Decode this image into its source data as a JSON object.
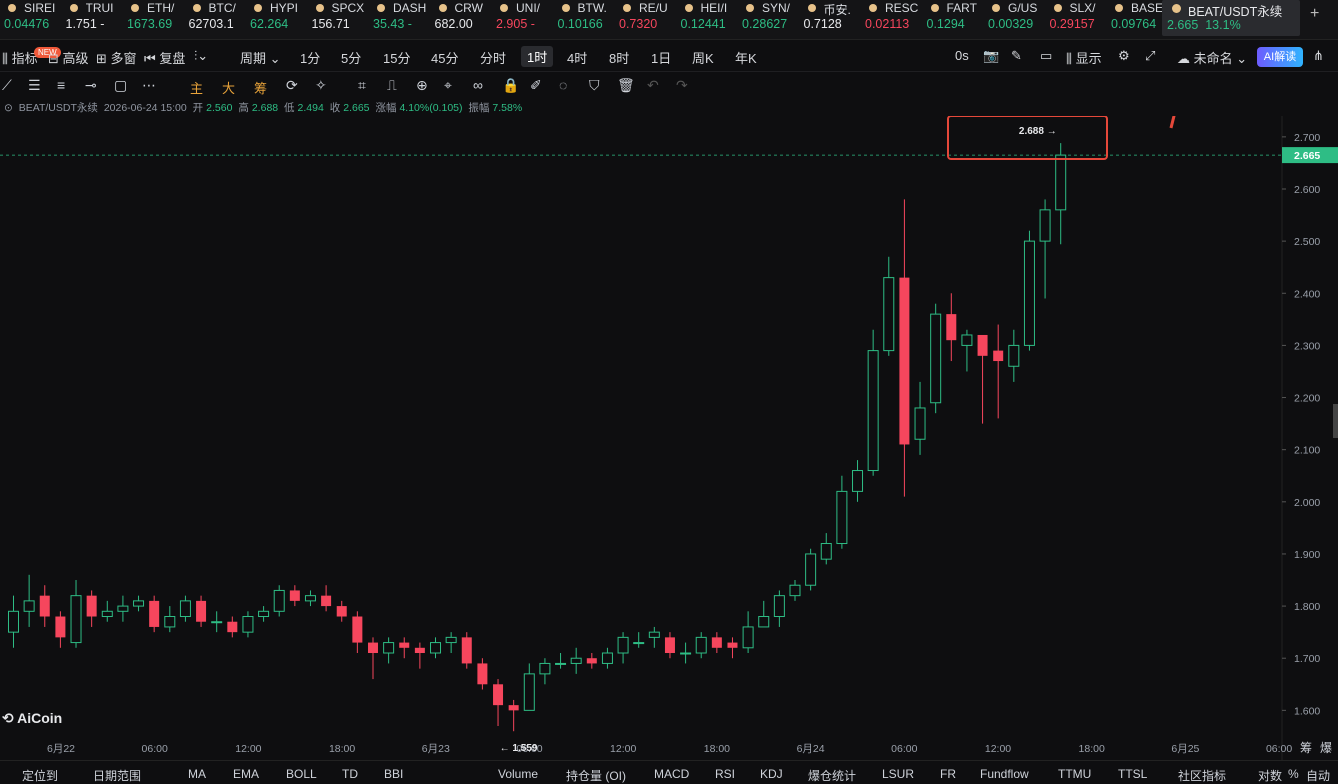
{
  "ticker": [
    {
      "name": "SIREI",
      "price": "0.04476",
      "dir": "up"
    },
    {
      "name": "TRUI",
      "price": "1.751 -",
      "dir": "wh"
    },
    {
      "name": "ETH/",
      "price": "1673.69",
      "dir": "up"
    },
    {
      "name": "BTC/",
      "price": "62703.1",
      "dir": "wh"
    },
    {
      "name": "HYPI",
      "price": "62.264",
      "dir": "up"
    },
    {
      "name": "SPCX",
      "price": "156.71",
      "dir": "wh"
    },
    {
      "name": "DASH",
      "price": "35.43 -",
      "dir": "up"
    },
    {
      "name": "CRW",
      "price": "682.00",
      "dir": "wh"
    },
    {
      "name": "UNI/",
      "price": "2.905 -",
      "dir": "dn"
    },
    {
      "name": "BTW.",
      "price": "0.10166",
      "dir": "up"
    },
    {
      "name": "RE/U",
      "price": "0.7320",
      "dir": "dn"
    },
    {
      "name": "HEI/I",
      "price": "0.12441",
      "dir": "up"
    },
    {
      "name": "SYN/",
      "price": "0.28627",
      "dir": "up"
    },
    {
      "name": "币安.",
      "price": "0.7128",
      "dir": "wh"
    },
    {
      "name": "RESC",
      "price": "0.02113",
      "dir": "dn"
    },
    {
      "name": "FART",
      "price": "0.1294",
      "dir": "up"
    },
    {
      "name": "G/US",
      "price": "0.00329",
      "dir": "up"
    },
    {
      "name": "SLX/",
      "price": "0.29157",
      "dir": "dn"
    },
    {
      "name": "BASE",
      "price": "0.09764",
      "dir": "up"
    }
  ],
  "active_ticker": {
    "name": "BEAT/USDT永续",
    "price": "2.665",
    "change": "13.1%"
  },
  "toolbar": {
    "indicators": "指标",
    "new_badge": "NEW",
    "advanced": "高级",
    "multi": "多窗",
    "replay": "复盘",
    "period": "周期",
    "periods": [
      "1分",
      "5分",
      "15分",
      "45分",
      "分时",
      "1时",
      "4时",
      "8时",
      "1日",
      "周K",
      "年K"
    ],
    "selected_period": "1时",
    "timer": "0s",
    "display": "显示",
    "layout_name": "未命名",
    "ai": "AI解读"
  },
  "drawbar": {
    "main": "主",
    "big": "大",
    "chip": "筹"
  },
  "info": {
    "symbol": "BEAT/USDT永续",
    "time": "2026-06-24 15:00",
    "open_label": "开",
    "open": "2.560",
    "high_label": "高",
    "high": "2.688",
    "low_label": "低",
    "low": "2.494",
    "close_label": "收",
    "close": "2.665",
    "chg_label": "涨幅",
    "chg": "4.10%(0.105)",
    "amp_label": "振幅",
    "amp": "7.58%"
  },
  "logo": "AiCoin",
  "bottom": {
    "items": [
      "定位到",
      "日期范围",
      "MA",
      "EMA",
      "BOLL",
      "TD",
      "BBI",
      "Volume",
      "持仓量 (OI)",
      "MACD",
      "RSI",
      "KDJ",
      "爆仓统计",
      "LSUR",
      "FR",
      "Fundflow",
      "TTMU",
      "TTSL",
      "社区指标",
      "对数",
      "%",
      "自动"
    ]
  },
  "colors": {
    "up": "#2ebd85",
    "down": "#f6465d",
    "accent_box": "#e5483a"
  },
  "chart_data": {
    "type": "candlestick",
    "symbol": "BEAT/USDT永续",
    "interval": "1h",
    "y_ticks": [
      1.6,
      1.7,
      1.8,
      1.9,
      2.0,
      2.1,
      2.2,
      2.3,
      2.4,
      2.5,
      2.6,
      2.7
    ],
    "ylim": [
      1.57,
      2.74
    ],
    "x_ticks": [
      "6月22",
      "06:00",
      "12:00",
      "18:00",
      "6月23",
      "06:00",
      "12:00",
      "18:00",
      "6月24",
      "06:00",
      "12:00",
      "18:00",
      "6月25",
      "06:00"
    ],
    "last_price": "2.665",
    "high_label": "2.688",
    "low_label": "1.559",
    "candles": [
      [
        1.75,
        1.79,
        1.82,
        1.72
      ],
      [
        1.79,
        1.81,
        1.86,
        1.76
      ],
      [
        1.82,
        1.78,
        1.84,
        1.76
      ],
      [
        1.78,
        1.74,
        1.79,
        1.72
      ],
      [
        1.73,
        1.82,
        1.85,
        1.72
      ],
      [
        1.82,
        1.78,
        1.83,
        1.76
      ],
      [
        1.78,
        1.79,
        1.81,
        1.77
      ],
      [
        1.79,
        1.8,
        1.82,
        1.77
      ],
      [
        1.8,
        1.81,
        1.82,
        1.79
      ],
      [
        1.81,
        1.76,
        1.82,
        1.75
      ],
      [
        1.76,
        1.78,
        1.8,
        1.75
      ],
      [
        1.78,
        1.81,
        1.82,
        1.77
      ],
      [
        1.81,
        1.77,
        1.82,
        1.76
      ],
      [
        1.77,
        1.77,
        1.79,
        1.75
      ],
      [
        1.77,
        1.75,
        1.78,
        1.74
      ],
      [
        1.75,
        1.78,
        1.79,
        1.74
      ],
      [
        1.78,
        1.79,
        1.8,
        1.77
      ],
      [
        1.79,
        1.83,
        1.84,
        1.78
      ],
      [
        1.83,
        1.81,
        1.84,
        1.8
      ],
      [
        1.81,
        1.82,
        1.83,
        1.8
      ],
      [
        1.82,
        1.8,
        1.84,
        1.79
      ],
      [
        1.8,
        1.78,
        1.81,
        1.77
      ],
      [
        1.78,
        1.73,
        1.79,
        1.71
      ],
      [
        1.73,
        1.71,
        1.74,
        1.66
      ],
      [
        1.71,
        1.73,
        1.74,
        1.69
      ],
      [
        1.73,
        1.72,
        1.74,
        1.7
      ],
      [
        1.72,
        1.71,
        1.73,
        1.68
      ],
      [
        1.71,
        1.73,
        1.74,
        1.7
      ],
      [
        1.73,
        1.74,
        1.75,
        1.71
      ],
      [
        1.74,
        1.69,
        1.75,
        1.68
      ],
      [
        1.69,
        1.65,
        1.7,
        1.64
      ],
      [
        1.65,
        1.61,
        1.66,
        1.57
      ],
      [
        1.61,
        1.6,
        1.62,
        1.56
      ],
      [
        1.6,
        1.67,
        1.69,
        1.6
      ],
      [
        1.67,
        1.69,
        1.7,
        1.65
      ],
      [
        1.69,
        1.69,
        1.71,
        1.68
      ],
      [
        1.69,
        1.7,
        1.72,
        1.67
      ],
      [
        1.7,
        1.69,
        1.71,
        1.68
      ],
      [
        1.69,
        1.71,
        1.72,
        1.68
      ],
      [
        1.71,
        1.74,
        1.75,
        1.69
      ],
      [
        1.73,
        1.73,
        1.75,
        1.72
      ],
      [
        1.74,
        1.75,
        1.76,
        1.72
      ],
      [
        1.74,
        1.71,
        1.75,
        1.7
      ],
      [
        1.71,
        1.71,
        1.73,
        1.69
      ],
      [
        1.71,
        1.74,
        1.75,
        1.7
      ],
      [
        1.74,
        1.72,
        1.75,
        1.71
      ],
      [
        1.73,
        1.72,
        1.74,
        1.7
      ],
      [
        1.72,
        1.76,
        1.79,
        1.71
      ],
      [
        1.76,
        1.78,
        1.81,
        1.76
      ],
      [
        1.78,
        1.82,
        1.83,
        1.76
      ],
      [
        1.82,
        1.84,
        1.85,
        1.81
      ],
      [
        1.84,
        1.9,
        1.91,
        1.83
      ],
      [
        1.89,
        1.92,
        1.94,
        1.88
      ],
      [
        1.92,
        2.02,
        2.05,
        1.91
      ],
      [
        2.02,
        2.06,
        2.08,
        2.0
      ],
      [
        2.06,
        2.29,
        2.33,
        2.05
      ],
      [
        2.29,
        2.43,
        2.47,
        2.28
      ],
      [
        2.43,
        2.11,
        2.58,
        2.01
      ],
      [
        2.12,
        2.18,
        2.23,
        2.09
      ],
      [
        2.19,
        2.36,
        2.38,
        2.17
      ],
      [
        2.36,
        2.31,
        2.4,
        2.27
      ],
      [
        2.3,
        2.32,
        2.33,
        2.25
      ],
      [
        2.32,
        2.28,
        2.31,
        2.15
      ],
      [
        2.29,
        2.27,
        2.34,
        2.16
      ],
      [
        2.26,
        2.3,
        2.33,
        2.23
      ],
      [
        2.3,
        2.5,
        2.52,
        2.29
      ],
      [
        2.5,
        2.56,
        2.58,
        2.39
      ],
      [
        2.56,
        2.665,
        2.688,
        2.494
      ]
    ]
  }
}
